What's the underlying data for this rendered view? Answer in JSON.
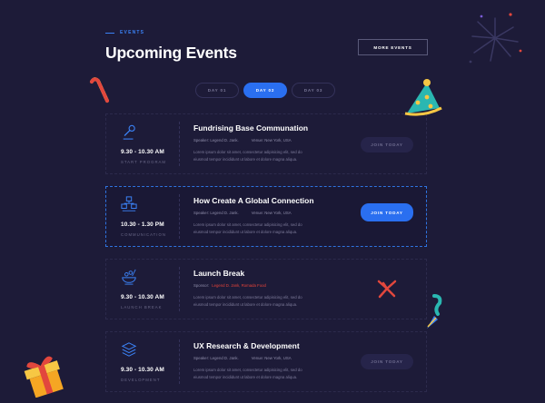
{
  "section": {
    "eyebrow": "EVENTS",
    "title": "Upcoming Events",
    "more_button": "MORE EVENTS"
  },
  "tabs": [
    {
      "label": "DAY 01",
      "active": false
    },
    {
      "label": "DAY 02",
      "active": true
    },
    {
      "label": "DAY 03",
      "active": false
    }
  ],
  "events": [
    {
      "icon": "microphone-icon",
      "time": "9.30 - 10.30 AM",
      "category": "START PROGRAM",
      "title": "Fundrising Base Communation",
      "speaker_label": "Speaker: Legend D. Jank.",
      "venue": "Venue: New York, USA",
      "description": "Lorem ipsum dolor sit amet, consectetur adipisicing elit, sed do eiusmod tempor incididunt ut labore et dolore magna aliqua.",
      "button": "JOIN TODAY"
    },
    {
      "icon": "network-icon",
      "time": "10.30 - 1.30 PM",
      "category": "COMMUNICATION",
      "title": "How Create A Global Connection",
      "speaker_label": "Speaker: Legend D. Jank.",
      "venue": "Venue: New York, USA",
      "description": "Lorem ipsum dolor sit amet, consectetur adipisicing elit, sed do eiusmod tempor incididunt ut labore et dolore magna aliqua.",
      "button": "JOIN TODAY"
    },
    {
      "icon": "food-bowl-icon",
      "time": "9.30 - 10.30 AM",
      "category": "LAUNCH BREAK",
      "title": "Launch Break",
      "speaker_label": "Sponsor:",
      "sponsor": "Legend D. Jank, Romada Food",
      "description": "Lorem ipsum dolor sit amet, consectetur adipisicing elit, sed do eiusmod tempor incididunt ut labore et dolore magna aliqua."
    },
    {
      "icon": "layers-icon",
      "time": "9.30 - 10.30 AM",
      "category": "DEVELOPMENT",
      "title": "UX Research & Development",
      "speaker_label": "Speaker: Legend D. Jank.",
      "venue": "Venue: New York, USA",
      "description": "Lorem ipsum dolor sit amet, consectetur adipisicing elit, sed do eiusmod tempor incididunt ut labore et dolore magna aliqua.",
      "button": "JOIN TODAY"
    }
  ],
  "colors": {
    "background": "#1d1b38",
    "accent": "#2a6ff0",
    "sponsor_red": "#e8443a"
  }
}
